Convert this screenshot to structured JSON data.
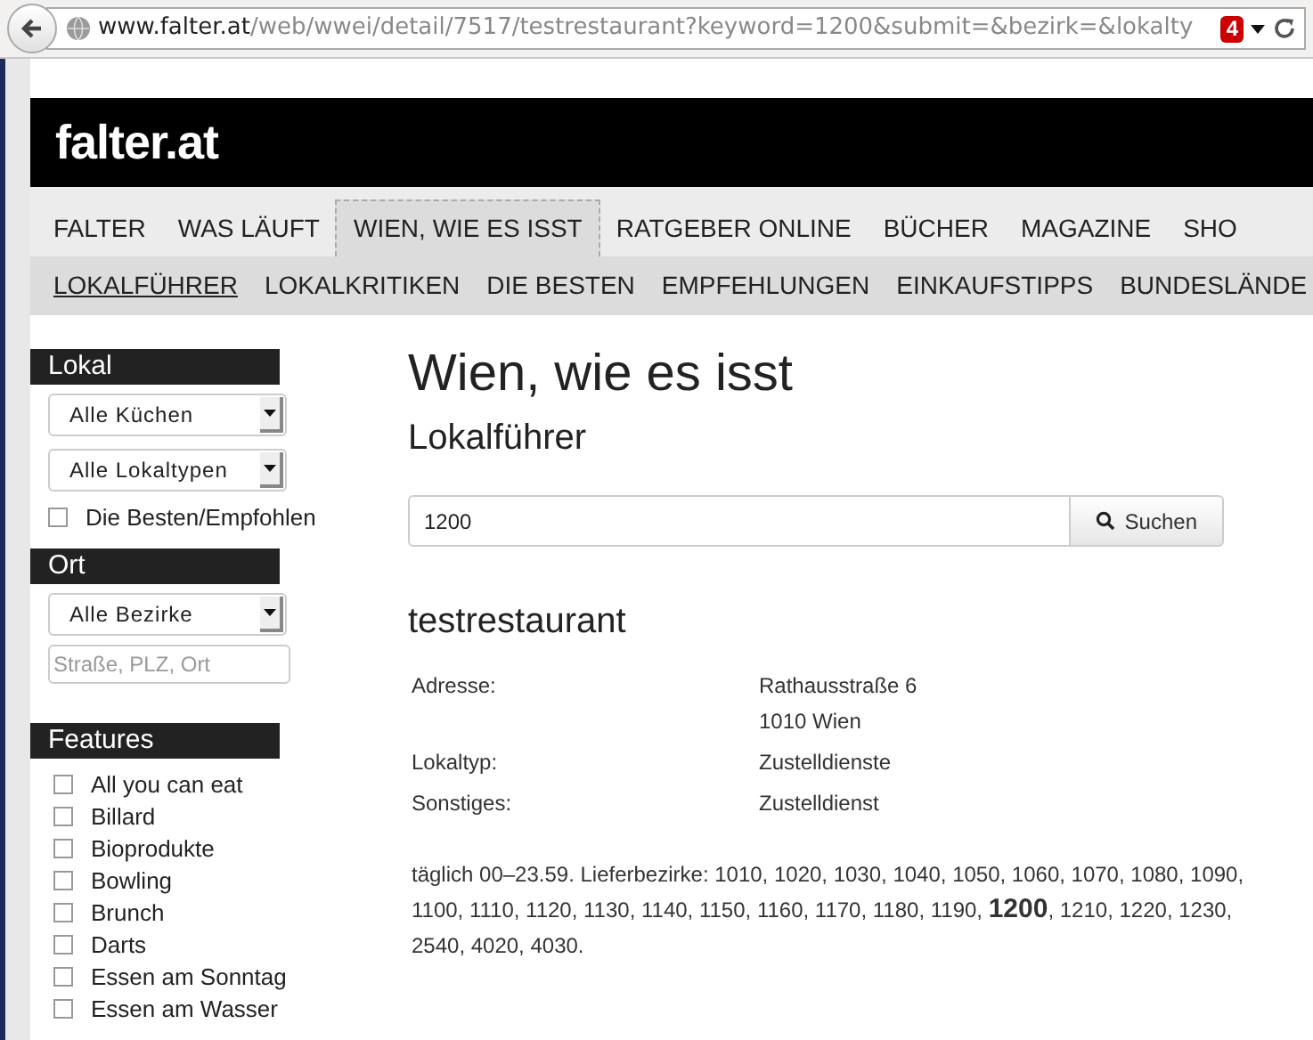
{
  "browser": {
    "url_host": "www.falter.at",
    "url_path": "/web/wwei/detail/7517/testrestaurant?keyword=1200&submit=&bezirk=&lokalty",
    "badge": "4"
  },
  "header": {
    "logo": "falter.at"
  },
  "nav": [
    {
      "label": "FALTER",
      "selected": false
    },
    {
      "label": "WAS LÄUFT",
      "selected": false
    },
    {
      "label": "WIEN, WIE ES ISST",
      "selected": true
    },
    {
      "label": "RATGEBER ONLINE",
      "selected": false
    },
    {
      "label": "BÜCHER",
      "selected": false
    },
    {
      "label": "MAGAZINE",
      "selected": false
    },
    {
      "label": "SHO",
      "selected": false
    }
  ],
  "subnav": [
    {
      "label": "LOKALFÜHRER",
      "selected": true
    },
    {
      "label": "LOKALKRITIKEN",
      "selected": false
    },
    {
      "label": "DIE BESTEN",
      "selected": false
    },
    {
      "label": "EMPFEHLUNGEN",
      "selected": false
    },
    {
      "label": "EINKAUFSTIPPS",
      "selected": false
    },
    {
      "label": "BUNDESLÄNDE",
      "selected": false
    }
  ],
  "sidebar": {
    "lokal": {
      "title": "Lokal",
      "selects": [
        "Alle Küchen",
        "Alle Lokaltypen"
      ],
      "best": {
        "label": "Die Besten/Empfohlen",
        "checked": false
      }
    },
    "ort": {
      "title": "Ort",
      "select": "Alle Bezirke",
      "placeholder": "Straße, PLZ, Ort"
    },
    "features": {
      "title": "Features",
      "items": [
        {
          "label": "All you can eat",
          "checked": false
        },
        {
          "label": "Billard",
          "checked": false
        },
        {
          "label": "Bioprodukte",
          "checked": false
        },
        {
          "label": "Bowling",
          "checked": false
        },
        {
          "label": "Brunch",
          "checked": false
        },
        {
          "label": "Darts",
          "checked": false
        },
        {
          "label": "Essen am Sonntag",
          "checked": false
        },
        {
          "label": "Essen am Wasser",
          "checked": false
        }
      ]
    }
  },
  "main": {
    "title": "Wien, wie es isst",
    "subtitle": "Lokalführer",
    "search": {
      "value": "1200",
      "button": "Suchen"
    },
    "restaurant": {
      "name": "testrestaurant",
      "details": [
        {
          "label": "Adresse:",
          "lines": [
            "Rathausstraße 6",
            "1010 Wien"
          ]
        },
        {
          "label": "Lokaltyp:",
          "lines": [
            "Zustelldienste"
          ]
        },
        {
          "label": "Sonstiges:",
          "lines": [
            "Zustelldienst"
          ]
        }
      ],
      "description": "täglich 00–23.59. Lieferbezirke: 1010, 1020, 1030, 1040, 1050, 1060, 1070, 1080, 1090, 1100, 1110, 1120, 1130, 1140, 1150, 1160, 1170, 1180, 1190, **1200**, 1210, 1220, 1230, 2540, 4020, 4030."
    }
  }
}
